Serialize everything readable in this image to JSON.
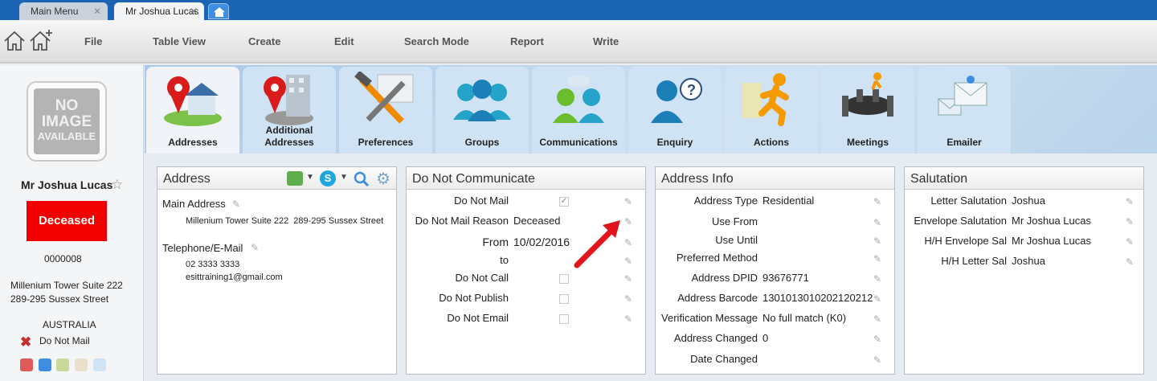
{
  "tabs": {
    "main_menu": "Main Menu",
    "contact": "Mr Joshua Lucas",
    "close_glyph": "✕"
  },
  "menu": {
    "file": "File",
    "table_view": "Table View",
    "create": "Create",
    "edit": "Edit",
    "search_mode": "Search Mode",
    "report": "Report",
    "write": "Write"
  },
  "sidebar": {
    "no_image_l1": "NO",
    "no_image_l2": "IMAGE",
    "no_image_l3": "AVAILABLE",
    "name": "Mr Joshua Lucas",
    "status": "Deceased",
    "id": "0000008",
    "address_line1": "Millenium Tower Suite 222",
    "address_line2": "289-295 Sussex Street",
    "country": "AUSTRALIA",
    "do_not_mail": "Do Not Mail"
  },
  "ribbon": [
    {
      "label": "Addresses",
      "icon": "map-pin-house-icon"
    },
    {
      "label": "Additional Addresses",
      "icon": "map-pin-building-icon"
    },
    {
      "label": "Preferences",
      "icon": "tools-icon"
    },
    {
      "label": "Groups",
      "icon": "group-icon"
    },
    {
      "label": "Communications",
      "icon": "communications-icon"
    },
    {
      "label": "Enquiry",
      "icon": "enquiry-icon"
    },
    {
      "label": "Actions",
      "icon": "running-man-icon"
    },
    {
      "label": "Meetings",
      "icon": "meeting-table-icon"
    },
    {
      "label": "Emailer",
      "icon": "envelopes-icon"
    }
  ],
  "address_panel": {
    "title": "Address",
    "main_address_label": "Main Address",
    "main_address_value": "Millenium Tower Suite 222  289-295 Sussex Street",
    "telephone_label": "Telephone/E-Mail",
    "phone": "02 3333 3333",
    "email": "esittraining1@gmail.com"
  },
  "dnc_panel": {
    "title": "Do Not Communicate",
    "rows": [
      {
        "label": "Do Not Mail",
        "value": "",
        "checked": true
      },
      {
        "label": "Do Not Mail Reason",
        "value": "Deceased"
      },
      {
        "label": "From",
        "value": "10/02/2016"
      },
      {
        "label": "to",
        "value": ""
      },
      {
        "label": "Do Not Call",
        "value": "",
        "checked": false
      },
      {
        "label": "Do Not Publish",
        "value": "",
        "checked": false
      },
      {
        "label": "Do Not Email",
        "value": "",
        "checked": false
      }
    ]
  },
  "address_info_panel": {
    "title": "Address Info",
    "rows": [
      {
        "label": "Address Type",
        "value": "Residential"
      },
      {
        "label": "Use From",
        "value": ""
      },
      {
        "label": "Use Until",
        "value": ""
      },
      {
        "label": "Preferred Method",
        "value": ""
      },
      {
        "label": "Address DPID",
        "value": "93676771"
      },
      {
        "label": "Address Barcode",
        "value": "1301013010202120212"
      },
      {
        "label": "Verification Message",
        "value": "No full match (K0)"
      },
      {
        "label": "Address Changed",
        "value": "0"
      },
      {
        "label": "Date Changed",
        "value": ""
      }
    ]
  },
  "salutation_panel": {
    "title": "Salutation",
    "rows": [
      {
        "label": "Letter Salutation",
        "value": "Joshua"
      },
      {
        "label": "Envelope Salutation",
        "value": "Mr Joshua Lucas"
      },
      {
        "label": "H/H Envelope Sal",
        "value": "Mr Joshua Lucas"
      },
      {
        "label": "H/H Letter Sal",
        "value": "Joshua"
      }
    ]
  },
  "colors": {
    "deceased_bg": "#f20000",
    "tab_strip": "#1b63b3",
    "arrow": "#e0141a"
  }
}
